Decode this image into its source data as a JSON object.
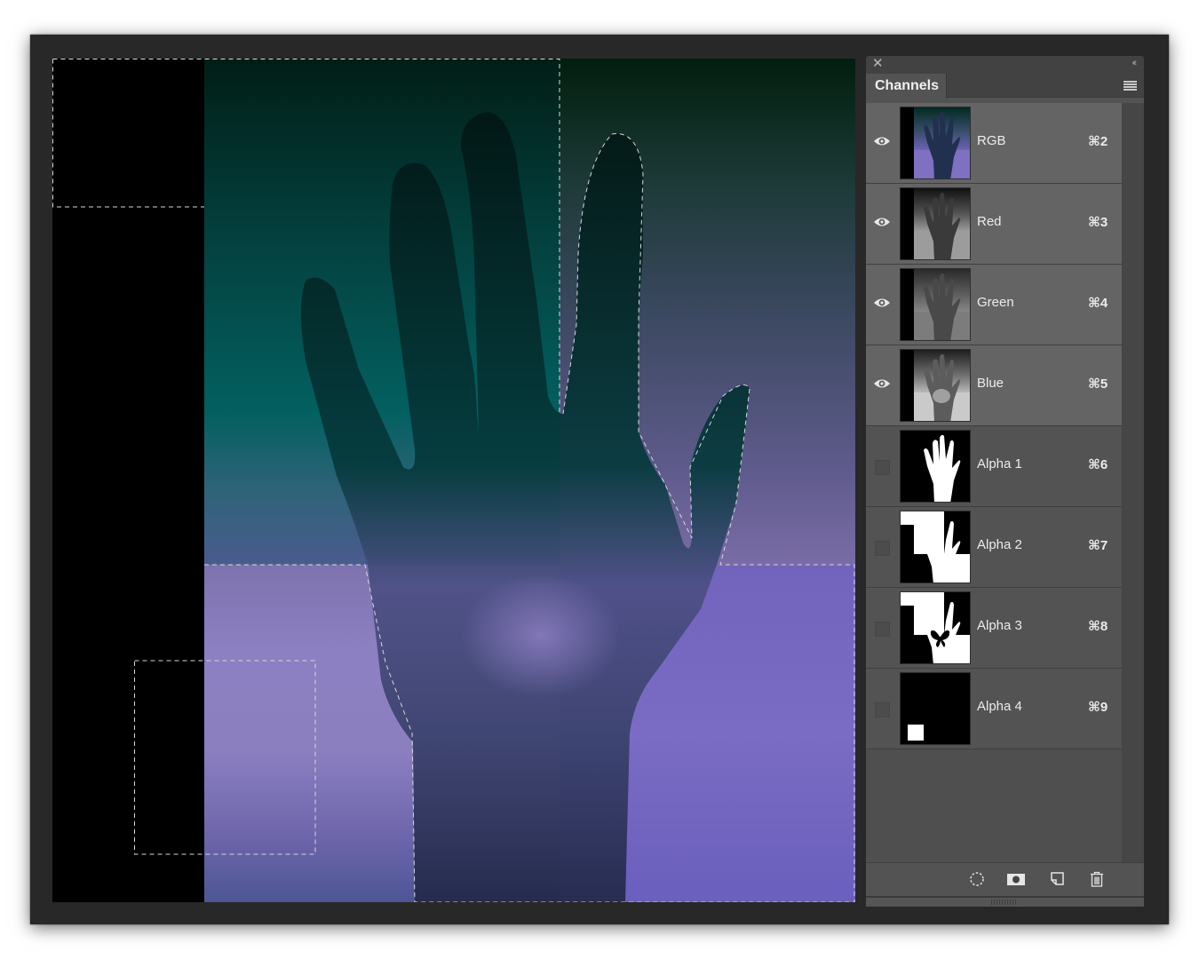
{
  "panel": {
    "title": "Channels",
    "close_icon": "close-icon",
    "collapse_icon": "double-chevron-left-icon",
    "menu_icon": "panel-menu-icon",
    "channels": [
      {
        "name": "RGB",
        "shortcut": "⌘2",
        "visible": true,
        "kind": "composite"
      },
      {
        "name": "Red",
        "shortcut": "⌘3",
        "visible": true,
        "kind": "color"
      },
      {
        "name": "Green",
        "shortcut": "⌘4",
        "visible": true,
        "kind": "color"
      },
      {
        "name": "Blue",
        "shortcut": "⌘5",
        "visible": true,
        "kind": "color"
      },
      {
        "name": "Alpha 1",
        "shortcut": "⌘6",
        "visible": false,
        "kind": "alpha"
      },
      {
        "name": "Alpha 2",
        "shortcut": "⌘7",
        "visible": false,
        "kind": "alpha"
      },
      {
        "name": "Alpha 3",
        "shortcut": "⌘8",
        "visible": false,
        "kind": "alpha"
      },
      {
        "name": "Alpha 4",
        "shortcut": "⌘9",
        "visible": false,
        "kind": "alpha"
      }
    ],
    "footer_buttons": [
      {
        "name": "load-channel-as-selection",
        "icon": "dotted-selection-icon"
      },
      {
        "name": "save-selection-as-channel",
        "icon": "mask-icon"
      },
      {
        "name": "create-new-channel",
        "icon": "new-page-icon"
      },
      {
        "name": "delete-channel",
        "icon": "trash-icon"
      }
    ]
  },
  "canvas": {
    "colors": {
      "teal_dark": "#021e16",
      "teal_mid": "#036060",
      "slate": "#4a5a8c",
      "lavender": "#8d80c2",
      "violet": "#7a6cc4",
      "navy": "#283058",
      "black": "#000000"
    }
  }
}
